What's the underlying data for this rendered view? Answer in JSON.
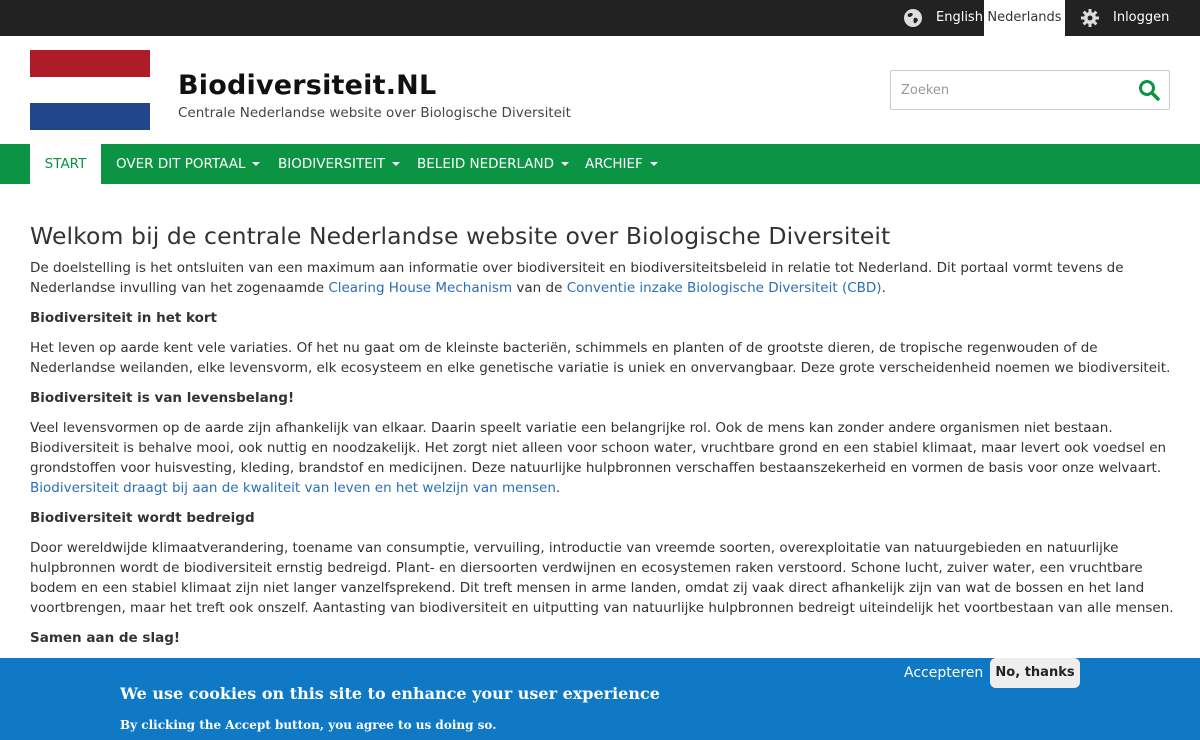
{
  "topbar": {
    "lang_en": "English",
    "lang_nl": "Nederlands",
    "login": "Inloggen"
  },
  "header": {
    "title": "Biodiversiteit.NL",
    "subtitle": "Centrale Nederlandse website over Biologische Diversiteit",
    "search_placeholder": "Zoeken",
    "flag_colors": [
      "#ae1c28",
      "#ffffff",
      "#21468b"
    ]
  },
  "nav": {
    "items": [
      {
        "label": "START"
      },
      {
        "label": "OVER DIT PORTAAL"
      },
      {
        "label": "BIODIVERSITEIT"
      },
      {
        "label": "BELEID NEDERLAND"
      },
      {
        "label": "ARCHIEF"
      }
    ]
  },
  "content": {
    "heading": "Welkom bij de centrale Nederlandse website over Biologische Diversiteit",
    "intro_a": "De doelstelling is het ontsluiten van een maximum aan informatie over biodiversiteit en biodiversiteitsbeleid in relatie tot Nederland. Dit portaal vormt tevens de Nederlandse invulling van het zogenaamde ",
    "intro_link1": "Clearing House Mechanism",
    "intro_b": " van de ",
    "intro_link2": "Conventie inzake Biologische Diversiteit (CBD)",
    "intro_c": ".",
    "h_kort": "Biodiversiteit in het kort",
    "p_kort": "Het leven op aarde kent vele variaties. Of het nu gaat om de kleinste bacteriën, schimmels en planten of de grootste dieren, de tropische regenwouden of de Nederlandse weilanden, elke levensvorm, elk ecosysteem en elke genetische variatie is uniek en onvervangbaar. Deze grote verscheidenheid noemen we biodiversiteit.",
    "h_belang": "Biodiversiteit is van levensbelang!",
    "p_belang_a": "Veel levensvormen op de aarde zijn afhankelijk van elkaar. Daarin speelt variatie een belangrijke rol. Ook de mens kan zonder andere organismen niet bestaan. Biodiversiteit is behalve mooi, ook nuttig en noodzakelijk. Het zorgt niet alleen voor schoon water, vruchtbare grond en een stabiel klimaat, maar levert ook voedsel en grondstoffen voor huisvesting, kleding, brandstof en medicijnen. Deze natuurlijke hulpbronnen verschaffen bestaanszekerheid en vormen de basis voor onze welvaart. ",
    "p_belang_link": "Biodiversiteit draagt bij aan de kwaliteit van leven en het welzijn van mensen",
    "p_belang_b": ".",
    "h_bedreigd": "Biodiversiteit wordt bedreigd",
    "p_bedreigd": "Door wereldwijde klimaatverandering, toename van consumptie, vervuiling, introductie van vreemde soorten, overexploitatie van natuurgebieden en natuurlijke hulpbronnen wordt de biodiversiteit ernstig bedreigd. Plant- en diersoorten verdwijnen en ecosystemen raken verstoord. Schone lucht, zuiver water, een vruchtbare bodem en een stabiel klimaat zijn niet langer vanzelfsprekend. Dit treft mensen in arme landen, omdat zij vaak direct afhankelijk zijn van wat de bossen en het land voortbrengen, maar het treft ook onszelf. Aantasting van biodiversiteit en uitputting van natuurlijke hulpbronnen bedreigt uiteindelijk het voortbestaan van alle mensen.",
    "h_samen": "Samen aan de slag!"
  },
  "cookie": {
    "title": "We use cookies on this site to enhance your user experience",
    "text": "By clicking the Accept button, you agree to us doing so.",
    "accept": "Accepteren",
    "decline": "No, thanks"
  }
}
